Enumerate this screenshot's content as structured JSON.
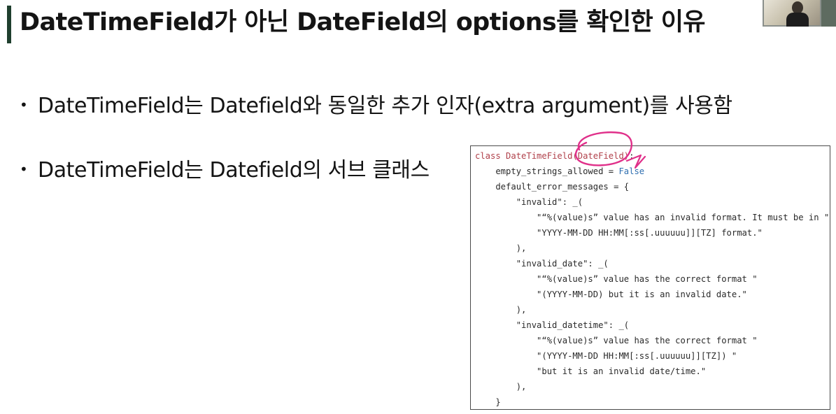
{
  "title": "DateTimeField가 아닌 DateField의 options를 확인한 이유",
  "bullets": [
    "DateTimeField는 Datefield와 동일한 추가 인자(extra argument)를 사용함",
    "DateTimeField는 Datefield의 서브 클래스"
  ],
  "bullet_symbol": "•",
  "code": {
    "line1_kw": "class",
    "line1_name": "DateTimeField",
    "line1_arg": "(DateField)",
    "line1_end": ":",
    "line2_pre": "    empty_strings_allowed = ",
    "line2_val": "False",
    "lines": [
      "    default_error_messages = {",
      "        \"invalid\": _(",
      "            \"“%(value)s” value has an invalid format. It must be in \"",
      "            \"YYYY-MM-DD HH:MM[:ss[.uuuuuu]][TZ] format.\"",
      "        ),",
      "        \"invalid_date\": _(",
      "            \"“%(value)s” value has the correct format \"",
      "            \"(YYYY-MM-DD) but it is an invalid date.\"",
      "        ),",
      "        \"invalid_datetime\": _(",
      "            \"“%(value)s” value has the correct format \"",
      "            \"(YYYY-MM-DD HH:MM[:ss[.uuuuuu]][TZ]) \"",
      "            \"but it is an invalid date/time.\"",
      "        ),",
      "    }"
    ]
  },
  "colors": {
    "title_bar": "#1f3f2e",
    "annotation": "#e0308a",
    "keyword": "#b0404a",
    "literal": "#2f6fb0"
  }
}
